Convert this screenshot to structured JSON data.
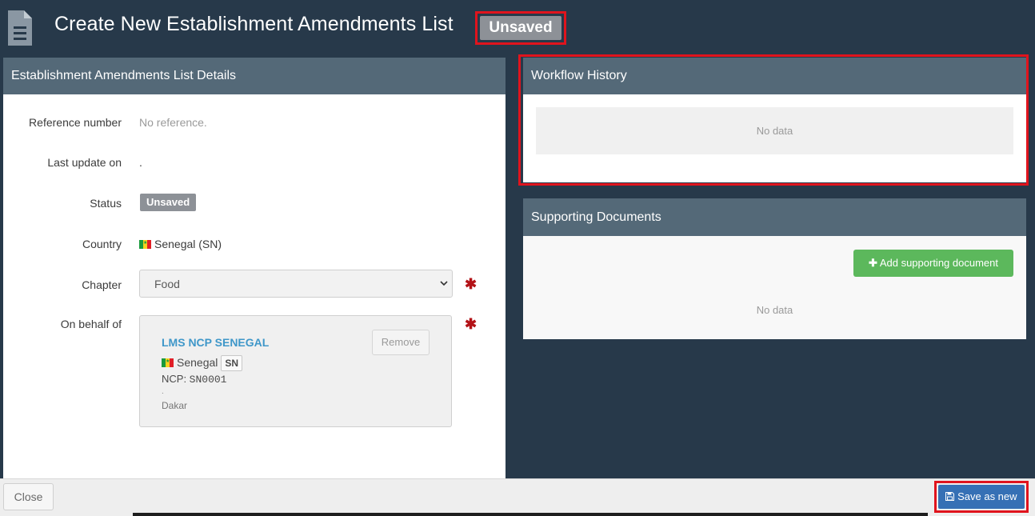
{
  "header": {
    "title": "Create New Establishment Amendments List",
    "badge": "Unsaved",
    "icon": "document-icon"
  },
  "details": {
    "heading": "Establishment Amendments List Details",
    "reference_label": "Reference number",
    "reference_value": "No reference.",
    "last_update_label": "Last update on",
    "last_update_value": ".",
    "status_label": "Status",
    "status_value": "Unsaved",
    "country_label": "Country",
    "country_value": "Senegal (SN)",
    "chapter_label": "Chapter",
    "chapter_value": "Food",
    "behalf_label": "On behalf of",
    "required_mark": "✱",
    "behalf": {
      "org_name": "LMS NCP SENEGAL",
      "remove_label": "Remove",
      "country": "Senegal",
      "country_code": "SN",
      "ncp_prefix": "NCP: ",
      "ncp_code": "SN0001",
      "dot": ".",
      "city": "Dakar"
    }
  },
  "workflow": {
    "heading": "Workflow History",
    "empty": "No data"
  },
  "documents": {
    "heading": "Supporting Documents",
    "add_label": "Add supporting document",
    "empty": "No data"
  },
  "footer": {
    "close_label": "Close",
    "save_label": "Save as new"
  },
  "colors": {
    "background": "#27394a",
    "panel_header": "#546978",
    "badge": "#8d9197",
    "link": "#3f97c9",
    "success": "#5cb85c",
    "primary": "#3570b5",
    "highlight": "#e0141d"
  }
}
